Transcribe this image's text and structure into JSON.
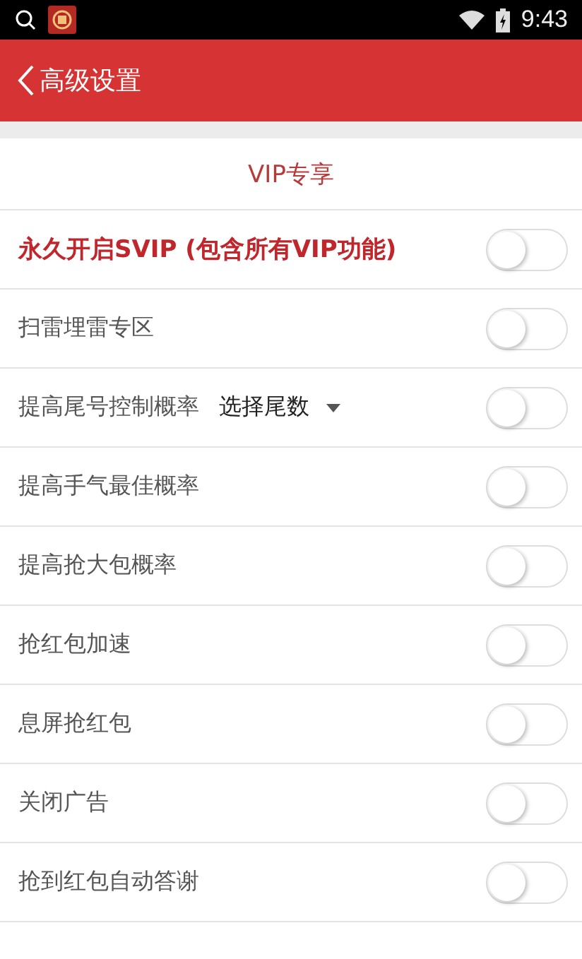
{
  "status_bar": {
    "time": "9:43"
  },
  "header": {
    "title": "高级设置"
  },
  "section": {
    "title": "VIP专享"
  },
  "settings": [
    {
      "kind": "featured",
      "label": "永久开启SVIP (包含所有VIP功能)",
      "on": false
    },
    {
      "kind": "plain",
      "label": "扫雷埋雷专区",
      "on": false
    },
    {
      "kind": "select",
      "label": "提高尾号控制概率",
      "select": "选择尾数",
      "on": false
    },
    {
      "kind": "plain",
      "label": "提高手气最佳概率",
      "on": false
    },
    {
      "kind": "plain",
      "label": "提高抢大包概率",
      "on": false
    },
    {
      "kind": "plain",
      "label": "抢红包加速",
      "on": false
    },
    {
      "kind": "plain",
      "label": "息屏抢红包",
      "on": false
    },
    {
      "kind": "plain",
      "label": "关闭广告",
      "on": false
    },
    {
      "kind": "plain",
      "label": "抢到红包自动答谢",
      "on": false
    }
  ]
}
